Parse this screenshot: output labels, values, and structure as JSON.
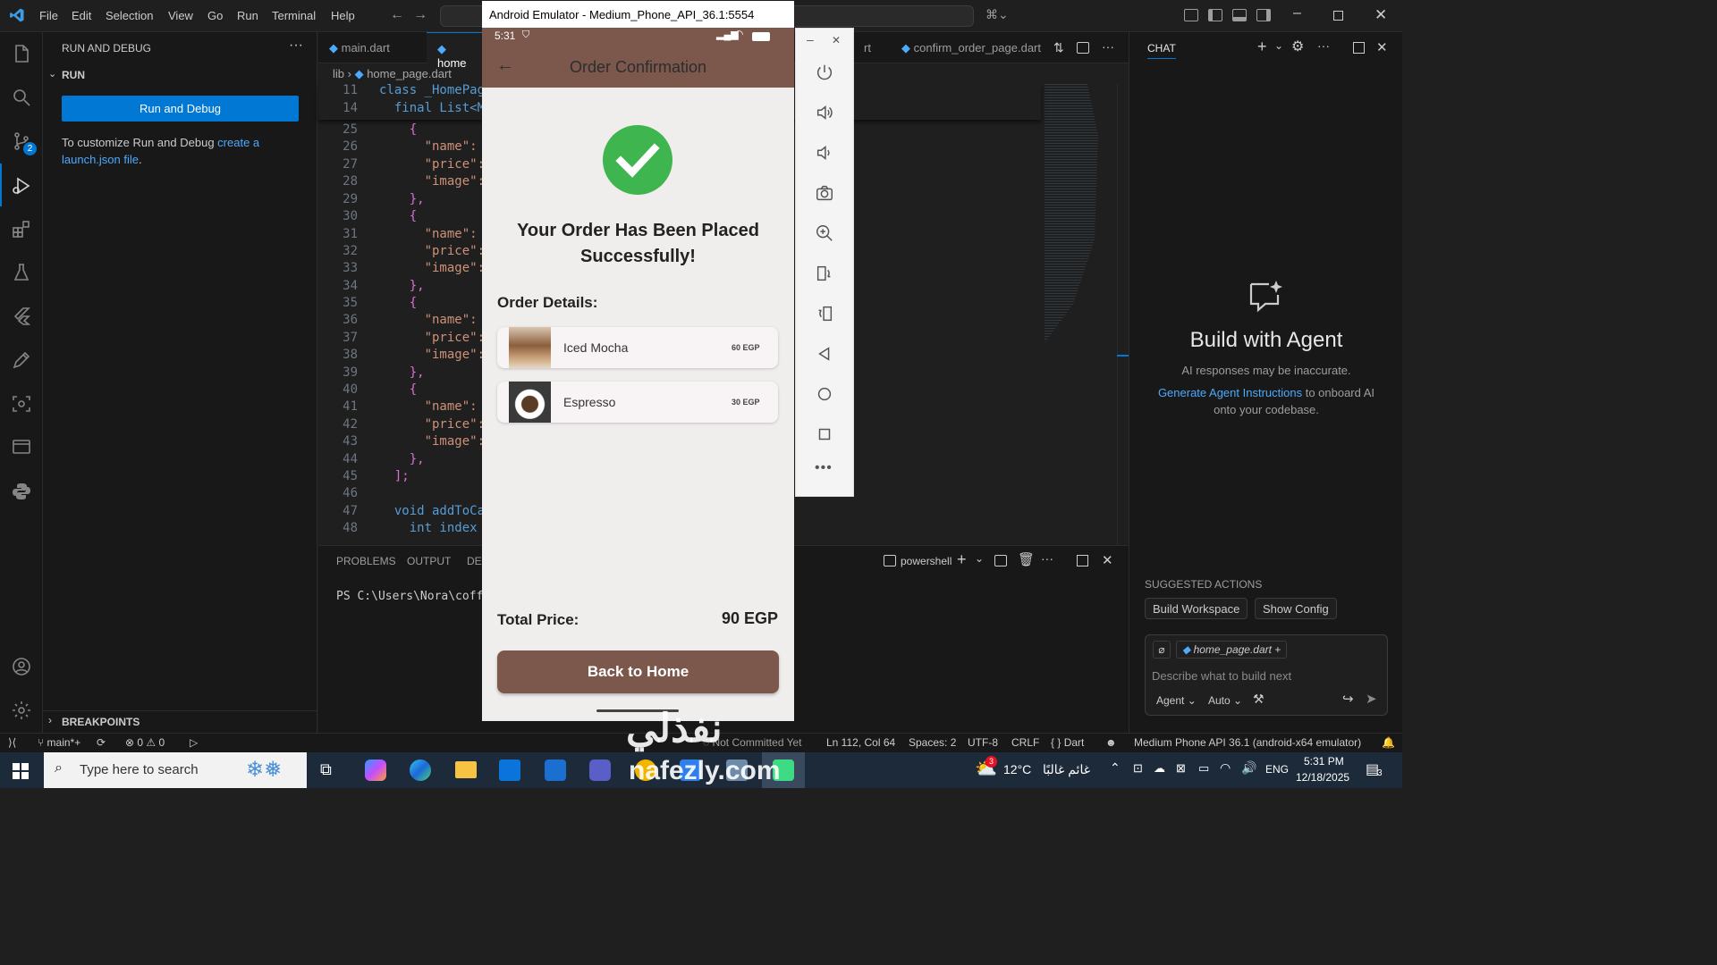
{
  "titlebar": {
    "menu": [
      "File",
      "Edit",
      "Selection",
      "View",
      "Go",
      "Run",
      "Terminal",
      "Help"
    ]
  },
  "sidebar": {
    "header": "RUN AND DEBUG",
    "section": "RUN",
    "run_button": "Run and Debug",
    "customize_text": "To customize Run and Debug",
    "customize_link_1": "create a",
    "customize_link_2": "launch.json file",
    "customize_end": ".",
    "breakpoints": "BREAKPOINTS",
    "scm_badge": "2"
  },
  "editor": {
    "tabs": [
      "main.dart",
      "home",
      "rt",
      "confirm_order_page.dart"
    ],
    "breadcrumb": [
      "lib",
      "home_page.dart"
    ],
    "lines": [
      {
        "n": "11",
        "code": "class _HomePage"
      },
      {
        "n": "14",
        "code": "  final List<Ma"
      },
      {
        "n": "25",
        "code": "    {"
      },
      {
        "n": "26",
        "code": "      \"name\": '"
      },
      {
        "n": "27",
        "code": "      \"price\":"
      },
      {
        "n": "28",
        "code": "      \"image\":"
      },
      {
        "n": "29",
        "code": "    },"
      },
      {
        "n": "30",
        "code": "    {"
      },
      {
        "n": "31",
        "code": "      \"name\": '"
      },
      {
        "n": "32",
        "code": "      \"price\":"
      },
      {
        "n": "33",
        "code": "      \"image\":"
      },
      {
        "n": "34",
        "code": "    },"
      },
      {
        "n": "35",
        "code": "    {"
      },
      {
        "n": "36",
        "code": "      \"name\": '"
      },
      {
        "n": "37",
        "code": "      \"price\":"
      },
      {
        "n": "38",
        "code": "      \"image\":"
      },
      {
        "n": "39",
        "code": "    },"
      },
      {
        "n": "40",
        "code": "    {"
      },
      {
        "n": "41",
        "code": "      \"name\": '"
      },
      {
        "n": "42",
        "code": "      \"price\":"
      },
      {
        "n": "43",
        "code": "      \"image\":"
      },
      {
        "n": "44",
        "code": "    },"
      },
      {
        "n": "45",
        "code": "  ];"
      },
      {
        "n": "46",
        "code": ""
      },
      {
        "n": "47",
        "code": "  void addToCar"
      },
      {
        "n": "48",
        "code": "    int index ="
      }
    ]
  },
  "panel": {
    "tabs": [
      "PROBLEMS",
      "OUTPUT",
      "DEB"
    ],
    "terminal_name": "powershell",
    "prompt": "PS C:\\Users\\Nora\\coffe"
  },
  "chat": {
    "header": "CHAT",
    "title": "Build with Agent",
    "disclaimer": "AI responses may be inaccurate.",
    "link": "Generate Agent Instructions",
    "link_rest_1": " to onboard AI",
    "link_rest_2": "onto your codebase.",
    "suggested_header": "SUGGESTED ACTIONS",
    "actions": [
      "Build Workspace",
      "Show Config"
    ],
    "context_file": "home_page.dart",
    "input_placeholder": "Describe what to build next",
    "mode": "Agent",
    "model": "Auto"
  },
  "statusbar": {
    "branch": "main*+",
    "errors": "0",
    "warnings": "0",
    "commit_state": "Not Committed Yet",
    "position": "Ln 112, Col 64",
    "spaces": "Spaces: 2",
    "encoding": "UTF-8",
    "eol": "CRLF",
    "language": "Dart",
    "device": "Medium Phone API 36.1 (android-x64 emulator)"
  },
  "taskbar": {
    "search_placeholder": "Type here to search",
    "weather_temp": "12°C",
    "weather_text": "غائم غالبًا",
    "weather_badge": "3",
    "lang": "ENG",
    "time": "5:31 PM",
    "date": "12/18/2025",
    "notif_count": "3"
  },
  "emulator": {
    "window_title": "Android Emulator - Medium_Phone_API_36.1:5554",
    "status_time": "5:31",
    "app_title": "Order Confirmation",
    "success_line_1": "Your Order Has Been Placed",
    "success_line_2": "Successfully!",
    "details_label": "Order Details:",
    "items": [
      {
        "name": "Iced Mocha",
        "price": "60 EGP"
      },
      {
        "name": "Espresso",
        "price": "30 EGP"
      }
    ],
    "total_label": "Total Price:",
    "total_value": "90 EGP",
    "back_button": "Back to Home",
    "colors": {
      "appbar": "#7b574c",
      "button": "#7b574c",
      "success": "#3fb54f"
    }
  },
  "watermark": {
    "text": "nafezly.com",
    "arabic": "نفذلي"
  }
}
